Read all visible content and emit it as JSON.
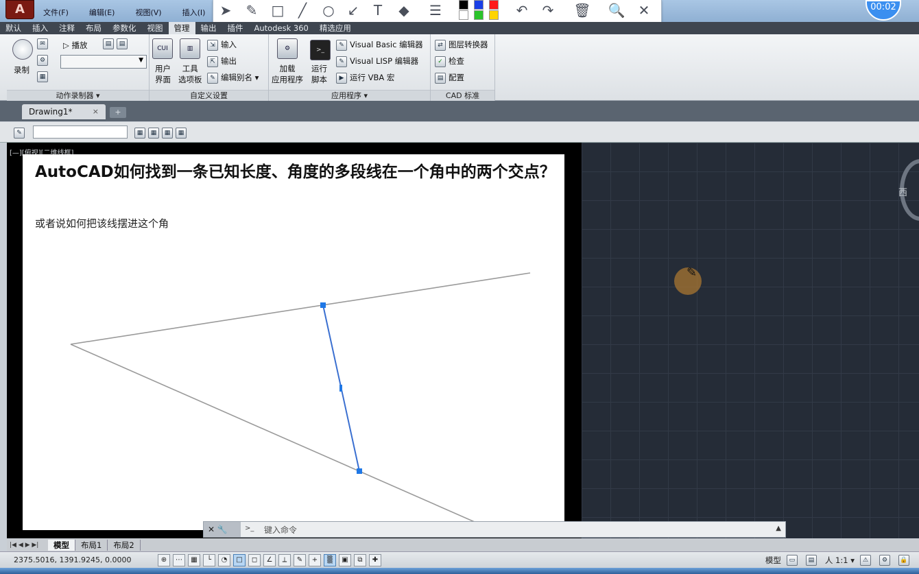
{
  "window": {
    "app_logo": "A",
    "menus": [
      "文件(F)",
      "编辑(E)",
      "视图(V)",
      "插入(I)"
    ],
    "timer": "00:02"
  },
  "ribbon": {
    "tabs": [
      "默认",
      "插入",
      "注释",
      "布局",
      "参数化",
      "视图",
      "管理",
      "输出",
      "插件",
      "Autodesk 360",
      "精选应用"
    ],
    "active_tab": "管理",
    "panels": {
      "action_recorder": {
        "title": "动作录制器 ▾",
        "record": "录制",
        "play": "▷ 播放"
      },
      "customization": {
        "title": "自定义设置",
        "ui_icon": "CUI",
        "user_interface": [
          "用户",
          "界面"
        ],
        "tool_palettes": [
          "工具",
          "选项板"
        ],
        "import": "输入",
        "export": "输出",
        "edit_aliases": "编辑别名 ▾"
      },
      "applications": {
        "title": "应用程序 ▾",
        "load_app": [
          "加载",
          "应用程序"
        ],
        "run_script": [
          "运行",
          "脚本"
        ],
        "vba_editor": "Visual Basic 编辑器",
        "lisp_editor": "Visual LISP 编辑器",
        "run_vba": "运行 VBA 宏"
      },
      "cad_standards": {
        "title": "CAD 标准",
        "layer_translator": "图层转换器",
        "check": "检查",
        "configure": "配置"
      }
    }
  },
  "document": {
    "tab": "Drawing1*",
    "close": "×",
    "new_tab": "+"
  },
  "viewport": {
    "label": "[—][俯视][二维线框]",
    "compass_west": "西"
  },
  "overlay": {
    "title": "AutoCAD如何找到一条已知长度、角度的多段线在一个角中的两个交点？",
    "subtitle": "或者说如何把该线摆进这个角"
  },
  "command": {
    "placeholder": "键入命令",
    "close": "✕",
    "settings": "🔧",
    "prompt_icon": ">_",
    "scroll": "▲"
  },
  "layouts": {
    "nav": "|◀ ◀ ▶ ▶|",
    "tabs": [
      "模型",
      "布局1",
      "布局2"
    ],
    "active": "模型"
  },
  "status": {
    "coords": "2375.5016,  1391.9245,  0.0000",
    "model": "模型",
    "scale": "人 1:1 ▾"
  },
  "annotation_toolbar": {
    "tools": [
      "select-arrow",
      "pen",
      "rectangle",
      "line",
      "circle",
      "arrow",
      "text",
      "eraser",
      "line-width",
      "undo",
      "redo",
      "delete",
      "zoom",
      "close"
    ],
    "colors": [
      "#000000",
      "#1a3fe6",
      "#ff1a1a",
      "#ffffff",
      "#2bc32b",
      "#ffd400"
    ]
  }
}
